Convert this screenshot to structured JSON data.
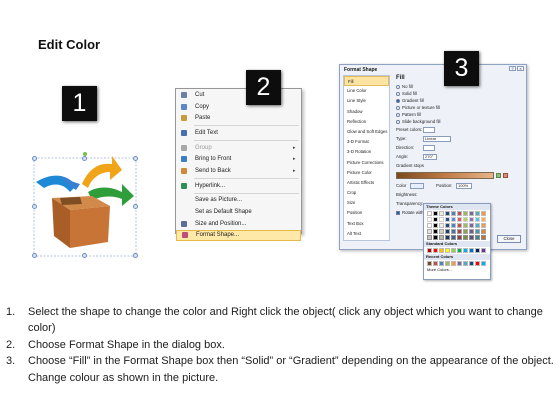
{
  "page_title": "Edit Color",
  "badges": [
    "1",
    "2",
    "3"
  ],
  "context_menu": {
    "items": [
      {
        "label": "Cut",
        "icon": "scissors-icon",
        "disabled": false,
        "submenu": false
      },
      {
        "label": "Copy",
        "icon": "copy-icon",
        "disabled": false,
        "submenu": false
      },
      {
        "label": "Paste",
        "icon": "paste-icon",
        "disabled": false,
        "submenu": false
      },
      {
        "label": "Edit Text",
        "icon": "edit-text-icon",
        "disabled": false,
        "submenu": false
      },
      {
        "label": "Group",
        "icon": "group-icon",
        "disabled": true,
        "submenu": true
      },
      {
        "label": "Bring to Front",
        "icon": "bring-front-icon",
        "disabled": false,
        "submenu": true
      },
      {
        "label": "Send to Back",
        "icon": "send-back-icon",
        "disabled": false,
        "submenu": true
      },
      {
        "label": "Hyperlink...",
        "icon": "hyperlink-icon",
        "disabled": false,
        "submenu": false
      },
      {
        "label": "Save as Picture...",
        "icon": "",
        "disabled": false,
        "submenu": false
      },
      {
        "label": "Set as Default Shape",
        "icon": "",
        "disabled": false,
        "submenu": false
      },
      {
        "label": "Size and Position...",
        "icon": "size-position-icon",
        "disabled": false,
        "submenu": false
      },
      {
        "label": "Format Shape...",
        "icon": "format-shape-icon",
        "disabled": false,
        "submenu": false,
        "highlighted": true
      }
    ]
  },
  "format_dialog": {
    "title": "Format Shape",
    "categories": [
      "Fill",
      "Line Color",
      "Line Style",
      "Shadow",
      "Reflection",
      "Glow and Soft Edges",
      "3-D Format",
      "3-D Rotation",
      "Picture Corrections",
      "Picture Color",
      "Artistic Effects",
      "Crop",
      "Size",
      "Position",
      "Text Box",
      "Alt Text"
    ],
    "selected_category": "Fill",
    "fill_heading": "Fill",
    "fill_options": [
      {
        "label": "No fill",
        "checked": false
      },
      {
        "label": "Solid fill",
        "checked": false
      },
      {
        "label": "Gradient fill",
        "checked": true
      },
      {
        "label": "Picture or texture fill",
        "checked": false
      },
      {
        "label": "Pattern fill",
        "checked": false
      },
      {
        "label": "Slide background fill",
        "checked": false
      }
    ],
    "preset_label": "Preset colors:",
    "type_label": "Type:",
    "type_value": "Linear",
    "direction_label": "Direction:",
    "angle_label": "Angle:",
    "angle_value": "270°",
    "gradient_stops_label": "Gradient stops",
    "color_label": "Color",
    "position_label": "Position:",
    "position_value": "100%",
    "brightness_label": "Brightness:",
    "transparency_label": "Transparency:",
    "rotate_label": "Rotate with shape",
    "close_label": "Close"
  },
  "color_palette": {
    "theme_label": "Theme Colors",
    "standard_label": "Standard Colors",
    "recent_label": "Recent Colors",
    "more_label": "More Colors...",
    "theme_colors": [
      "#ffffff",
      "#000000",
      "#eeece1",
      "#1f497d",
      "#4f81bd",
      "#c0504d",
      "#9bbb59",
      "#8064a2",
      "#4bacc6",
      "#f79646"
    ],
    "standard_colors": [
      "#c00000",
      "#ff0000",
      "#ffc000",
      "#ffff00",
      "#92d050",
      "#00b050",
      "#00b0f0",
      "#0070c0",
      "#002060",
      "#7030a0"
    ],
    "recent_colors": [
      "#7a4a20",
      "#c0504d",
      "#4f81bd",
      "#9bbb59",
      "#f79646",
      "#8064a2",
      "#4bacc6",
      "#1f497d",
      "#ff0000",
      "#00b0f0"
    ]
  },
  "instructions": [
    {
      "num": "1.",
      "text": "Select the shape to change the color and Right click the object( click any object which you want to change color)"
    },
    {
      "num": "2.",
      "text": "Choose Format Shape in the dialog box."
    },
    {
      "num": "3.",
      "text": "Choose “Fill” in the Format Shape box then “Solid” or “Gradient” depending on the appearance of the object. Change colour as shown in the picture."
    }
  ]
}
